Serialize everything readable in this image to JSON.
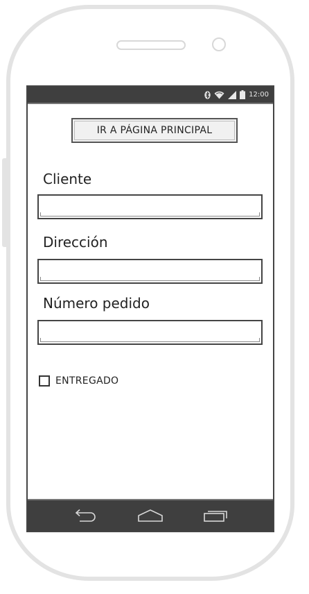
{
  "device": {
    "status_bar": {
      "time": "12:00",
      "icons": [
        "bluetooth-icon",
        "wifi-icon",
        "signal-icon",
        "battery-icon"
      ]
    },
    "nav_bar": {
      "icons": [
        "back-icon",
        "home-icon",
        "recent-apps-icon"
      ]
    }
  },
  "app": {
    "home_button_label": "IR A PÁGINA PRINCIPAL",
    "fields": [
      {
        "label": "Cliente",
        "value": "",
        "placeholder": ""
      },
      {
        "label": "Dirección",
        "value": "",
        "placeholder": ""
      },
      {
        "label": "Número pedido",
        "value": "",
        "placeholder": ""
      }
    ],
    "delivered_checkbox": {
      "label": "ENTREGADO",
      "checked": false
    }
  },
  "colors": {
    "bars": "#3f3f3f",
    "frame": "#e3e3e3",
    "outline": "#444444"
  }
}
